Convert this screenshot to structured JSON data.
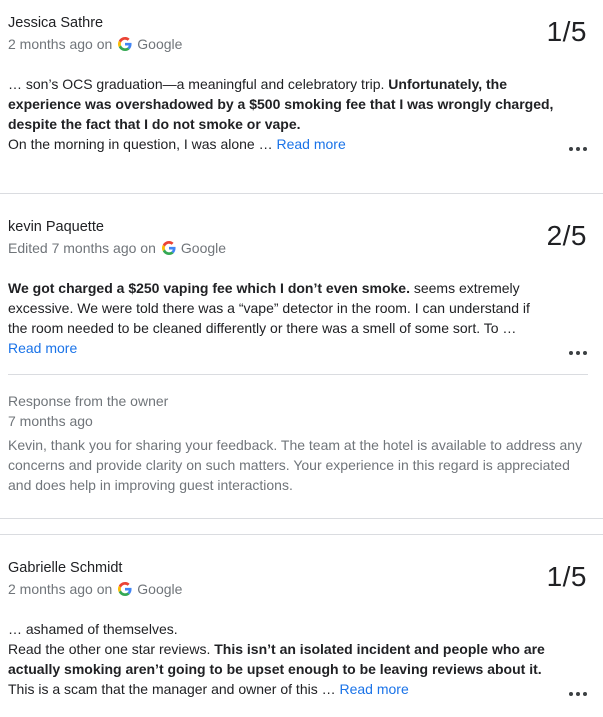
{
  "reviews": [
    {
      "author": "Jessica Sathre",
      "time": "2 months ago on",
      "source": "Google",
      "rating": "1/5",
      "text_1": "… son’s OCS graduation—a meaningful and celebratory trip. ",
      "text_bold": "Unfortunately, the experience was overshadowed by a $500 smoking fee that I was wrongly charged, despite the fact that I do not smoke or vape.",
      "text_2": "On the morning in question, I was alone … ",
      "read_more": "Read more"
    },
    {
      "author": "kevin Paquette",
      "time": "Edited 7 months ago on",
      "source": "Google",
      "rating": "2/5",
      "text_bold": "We got charged a $250 vaping fee which I don’t even smoke.",
      "text_1": " seems extremely excessive. We were told there was a “vape” detector in the room. I can understand if the room needed to be cleaned differently or there was a smell of some sort. To …",
      "read_more": "Read more",
      "owner_response": {
        "title": "Response from the owner",
        "time": "7 months ago",
        "text": "Kevin, thank you for sharing your feedback. The team at the hotel is available to address any concerns and provide clarity on such matters. Your experience in this regard is appreciated and does help in improving guest interactions."
      }
    },
    {
      "author": "Gabrielle Schmidt",
      "time": "2 months ago on",
      "source": "Google",
      "rating": "1/5",
      "text_1": "… ashamed of themselves.",
      "text_2": "Read the other one star reviews. ",
      "text_bold": "This isn’t an isolated incident and people who are actually smoking aren’t going to be upset enough to be leaving reviews about it.",
      "text_3": " This is a scam that the manager and owner of this … ",
      "read_more": "Read more"
    }
  ]
}
